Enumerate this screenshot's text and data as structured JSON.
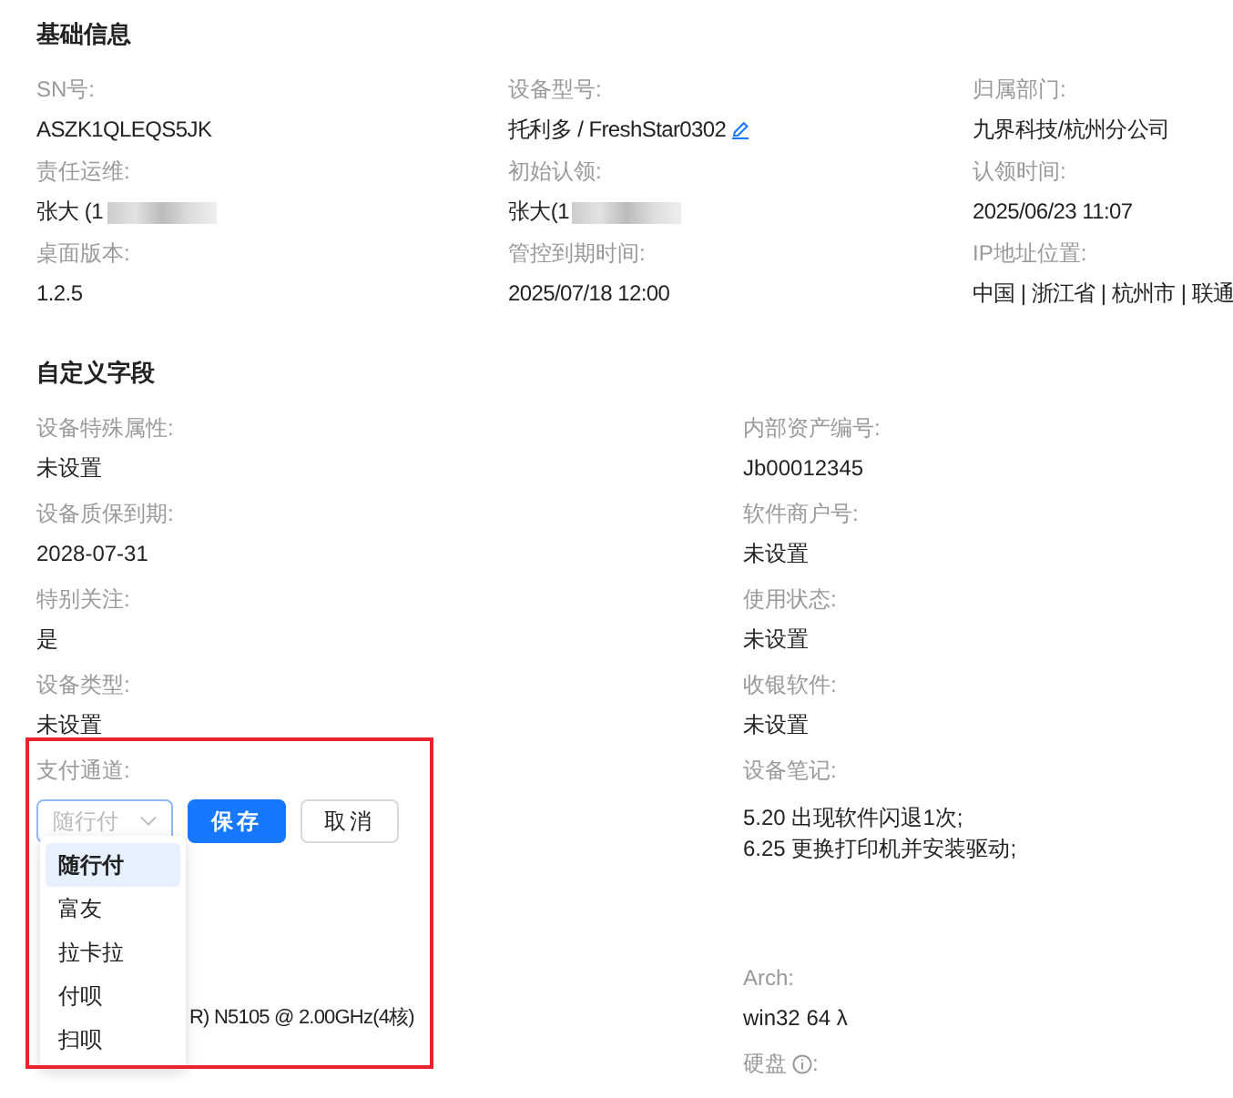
{
  "basic": {
    "title": "基础信息",
    "fields": [
      {
        "label": "SN号:",
        "value": "ASZK1QLEQS5JK"
      },
      {
        "label": "设备型号:",
        "value": "托利多  / FreshStar0302",
        "editable": true
      },
      {
        "label": "归属部门:",
        "value": "九界科技/杭州分公司"
      },
      {
        "label": "责任运维:",
        "value": "张大 (1",
        "redacted": true
      },
      {
        "label": "初始认领:",
        "value": "张大(1",
        "redacted": true
      },
      {
        "label": "认领时间:",
        "value": "2025/06/23 11:07"
      },
      {
        "label": "桌面版本:",
        "value": "1.2.5"
      },
      {
        "label": "管控到期时间:",
        "value": "2025/07/18 12:00"
      },
      {
        "label": "IP地址位置:",
        "value": "中国 | 浙江省 | 杭州市 | 联通"
      }
    ]
  },
  "custom": {
    "title": "自定义字段",
    "rows": [
      [
        {
          "kind": "text",
          "label": "设备特殊属性:",
          "value": "未设置"
        },
        {
          "kind": "text",
          "label": "内部资产编号:",
          "value": "Jb00012345"
        }
      ],
      [
        {
          "kind": "text",
          "label": "设备质保到期:",
          "value": "2028-07-31"
        },
        {
          "kind": "text",
          "label": "软件商户号:",
          "value": "未设置"
        }
      ],
      [
        {
          "kind": "text",
          "label": "特别关注:",
          "value": "是"
        },
        {
          "kind": "text",
          "label": "使用状态:",
          "value": "未设置"
        }
      ],
      [
        {
          "kind": "text",
          "label": "设备类型:",
          "value": "未设置"
        },
        {
          "kind": "text",
          "label": "收银软件:",
          "value": "未设置"
        }
      ],
      [
        {
          "kind": "select",
          "label": "支付通道:",
          "placeholder": "随行付",
          "buttons": [
            "保存",
            "取消"
          ],
          "options": [
            {
              "label": "随行付",
              "selected": true
            },
            {
              "label": "富友",
              "selected": false
            },
            {
              "label": "拉卡拉",
              "selected": false
            },
            {
              "label": "付呗",
              "selected": false
            },
            {
              "label": "扫呗",
              "selected": false
            }
          ]
        },
        {
          "kind": "notes",
          "label": "设备笔记:",
          "lines": [
            "5.20  出现软件闪退1次;",
            "6.25  更换打印机并安装驱动;"
          ]
        }
      ],
      [
        {
          "kind": "covered",
          "value": "R) N5105 @ 2.00GHz(4核)"
        },
        {
          "kind": "text",
          "label": "Arch:",
          "value": "win32 64 λ"
        }
      ],
      [
        {
          "kind": "none"
        },
        {
          "kind": "labelonly",
          "label": "硬盘",
          "info": true,
          "suffix": ":"
        }
      ]
    ]
  }
}
